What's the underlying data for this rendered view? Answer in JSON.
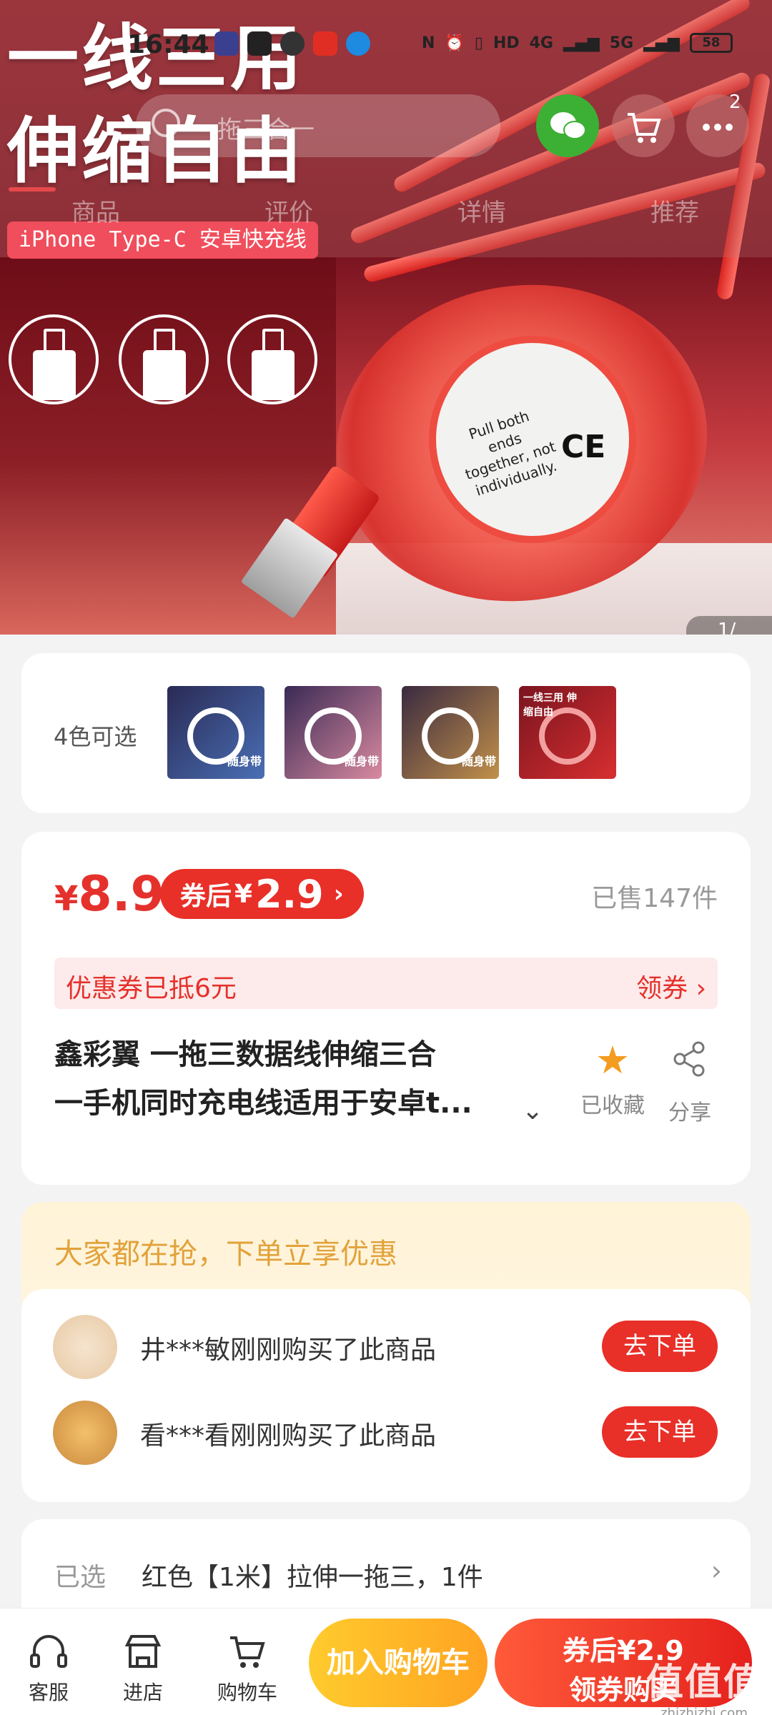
{
  "status_bar": {
    "time": "16:44",
    "network": "4G",
    "network2": "5G",
    "hd": "HD",
    "battery": "58"
  },
  "hero": {
    "title_line1": "一线三用",
    "title_line2": "伸缩自由",
    "tag": "iPhone Type-C 安卓快充线",
    "reel_text": "Pull both ends together, not individually.",
    "ce_mark": "CE",
    "page_counter": "1/"
  },
  "header": {
    "search_placeholder": "一拖三合一",
    "more_badge": "2",
    "tabs": [
      "商品",
      "评价",
      "详情",
      "推荐"
    ]
  },
  "colors": {
    "label": "4色可选",
    "swatches": [
      {
        "label": "随身带",
        "color": "#4a6fb5"
      },
      {
        "label": "随身带",
        "color": "#d98aa0"
      },
      {
        "label": "随身带",
        "color": "#c2904a"
      },
      {
        "label": "一线三用 伸缩自由",
        "color": "#d72f2f"
      }
    ]
  },
  "price": {
    "currency": "¥",
    "amount": "8.9",
    "coupon_prefix": "券后",
    "coupon_currency": "¥",
    "coupon_amount": "2.9",
    "coupon_chevron": "›",
    "sold": "已售147件",
    "discount_text": "优惠券已抵6元",
    "get_coupon": "领券 ›"
  },
  "product": {
    "title_line1": "鑫彩翼 一拖三数据线伸缩三合",
    "title_line2": "一手机同时充电线适用于安卓t...",
    "expand": "⌄",
    "fav_icon": "★",
    "fav_label": "已收藏",
    "share_label": "分享"
  },
  "rush": {
    "title": "大家都在抢，下单立享优惠",
    "buyers": [
      {
        "text": "井***敏刚刚购买了此商品",
        "button": "去下单"
      },
      {
        "text": "看***看刚刚购买了此商品",
        "button": "去下单"
      }
    ]
  },
  "selected": {
    "label": "已选",
    "value": "红色【1米】拉伸一拖三，1件",
    "chevron": "›"
  },
  "bottom_bar": {
    "service": "客服",
    "store": "进店",
    "cart": "购物车",
    "add_to_cart": "加入购物车",
    "buy_line1": "券后¥2.9",
    "buy_line2": "领券购买"
  },
  "watermark": {
    "main": "值值值",
    "sub": "zhizhizhi.com"
  },
  "colors_theme": {
    "accent_red": "#e82f28",
    "accent_yellow": "#ffa321",
    "wechat_green": "#3cb034"
  }
}
